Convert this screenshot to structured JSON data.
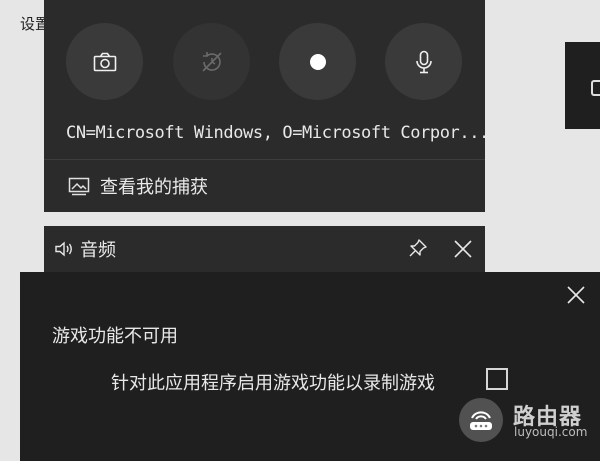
{
  "background": {
    "settings_label": "设置"
  },
  "capture": {
    "buttons": [
      {
        "icon": "camera-icon",
        "action": "screenshot"
      },
      {
        "icon": "record-last-disabled-icon",
        "action": "record-last-30s"
      },
      {
        "icon": "record-dot-icon",
        "action": "start-recording"
      },
      {
        "icon": "microphone-icon",
        "action": "toggle-mic"
      }
    ],
    "certificate_text": "CN=Microsoft Windows, O=Microsoft Corpor...",
    "gallery_label": "查看我的捕获"
  },
  "audio": {
    "title": "音频"
  },
  "dialog": {
    "heading": "游戏功能不可用",
    "option_label": "针对此应用程序启用游戏功能以录制游戏",
    "checkbox_checked": false
  },
  "watermark": {
    "name": "路由器",
    "url": "luyouqi.com"
  },
  "colors": {
    "panel_bg": "#2b2b2b",
    "dialog_bg": "#1f1f1f",
    "button_bg": "#3a3a3a",
    "text": "#eaeaea",
    "page_bg": "#e6e6e6"
  }
}
